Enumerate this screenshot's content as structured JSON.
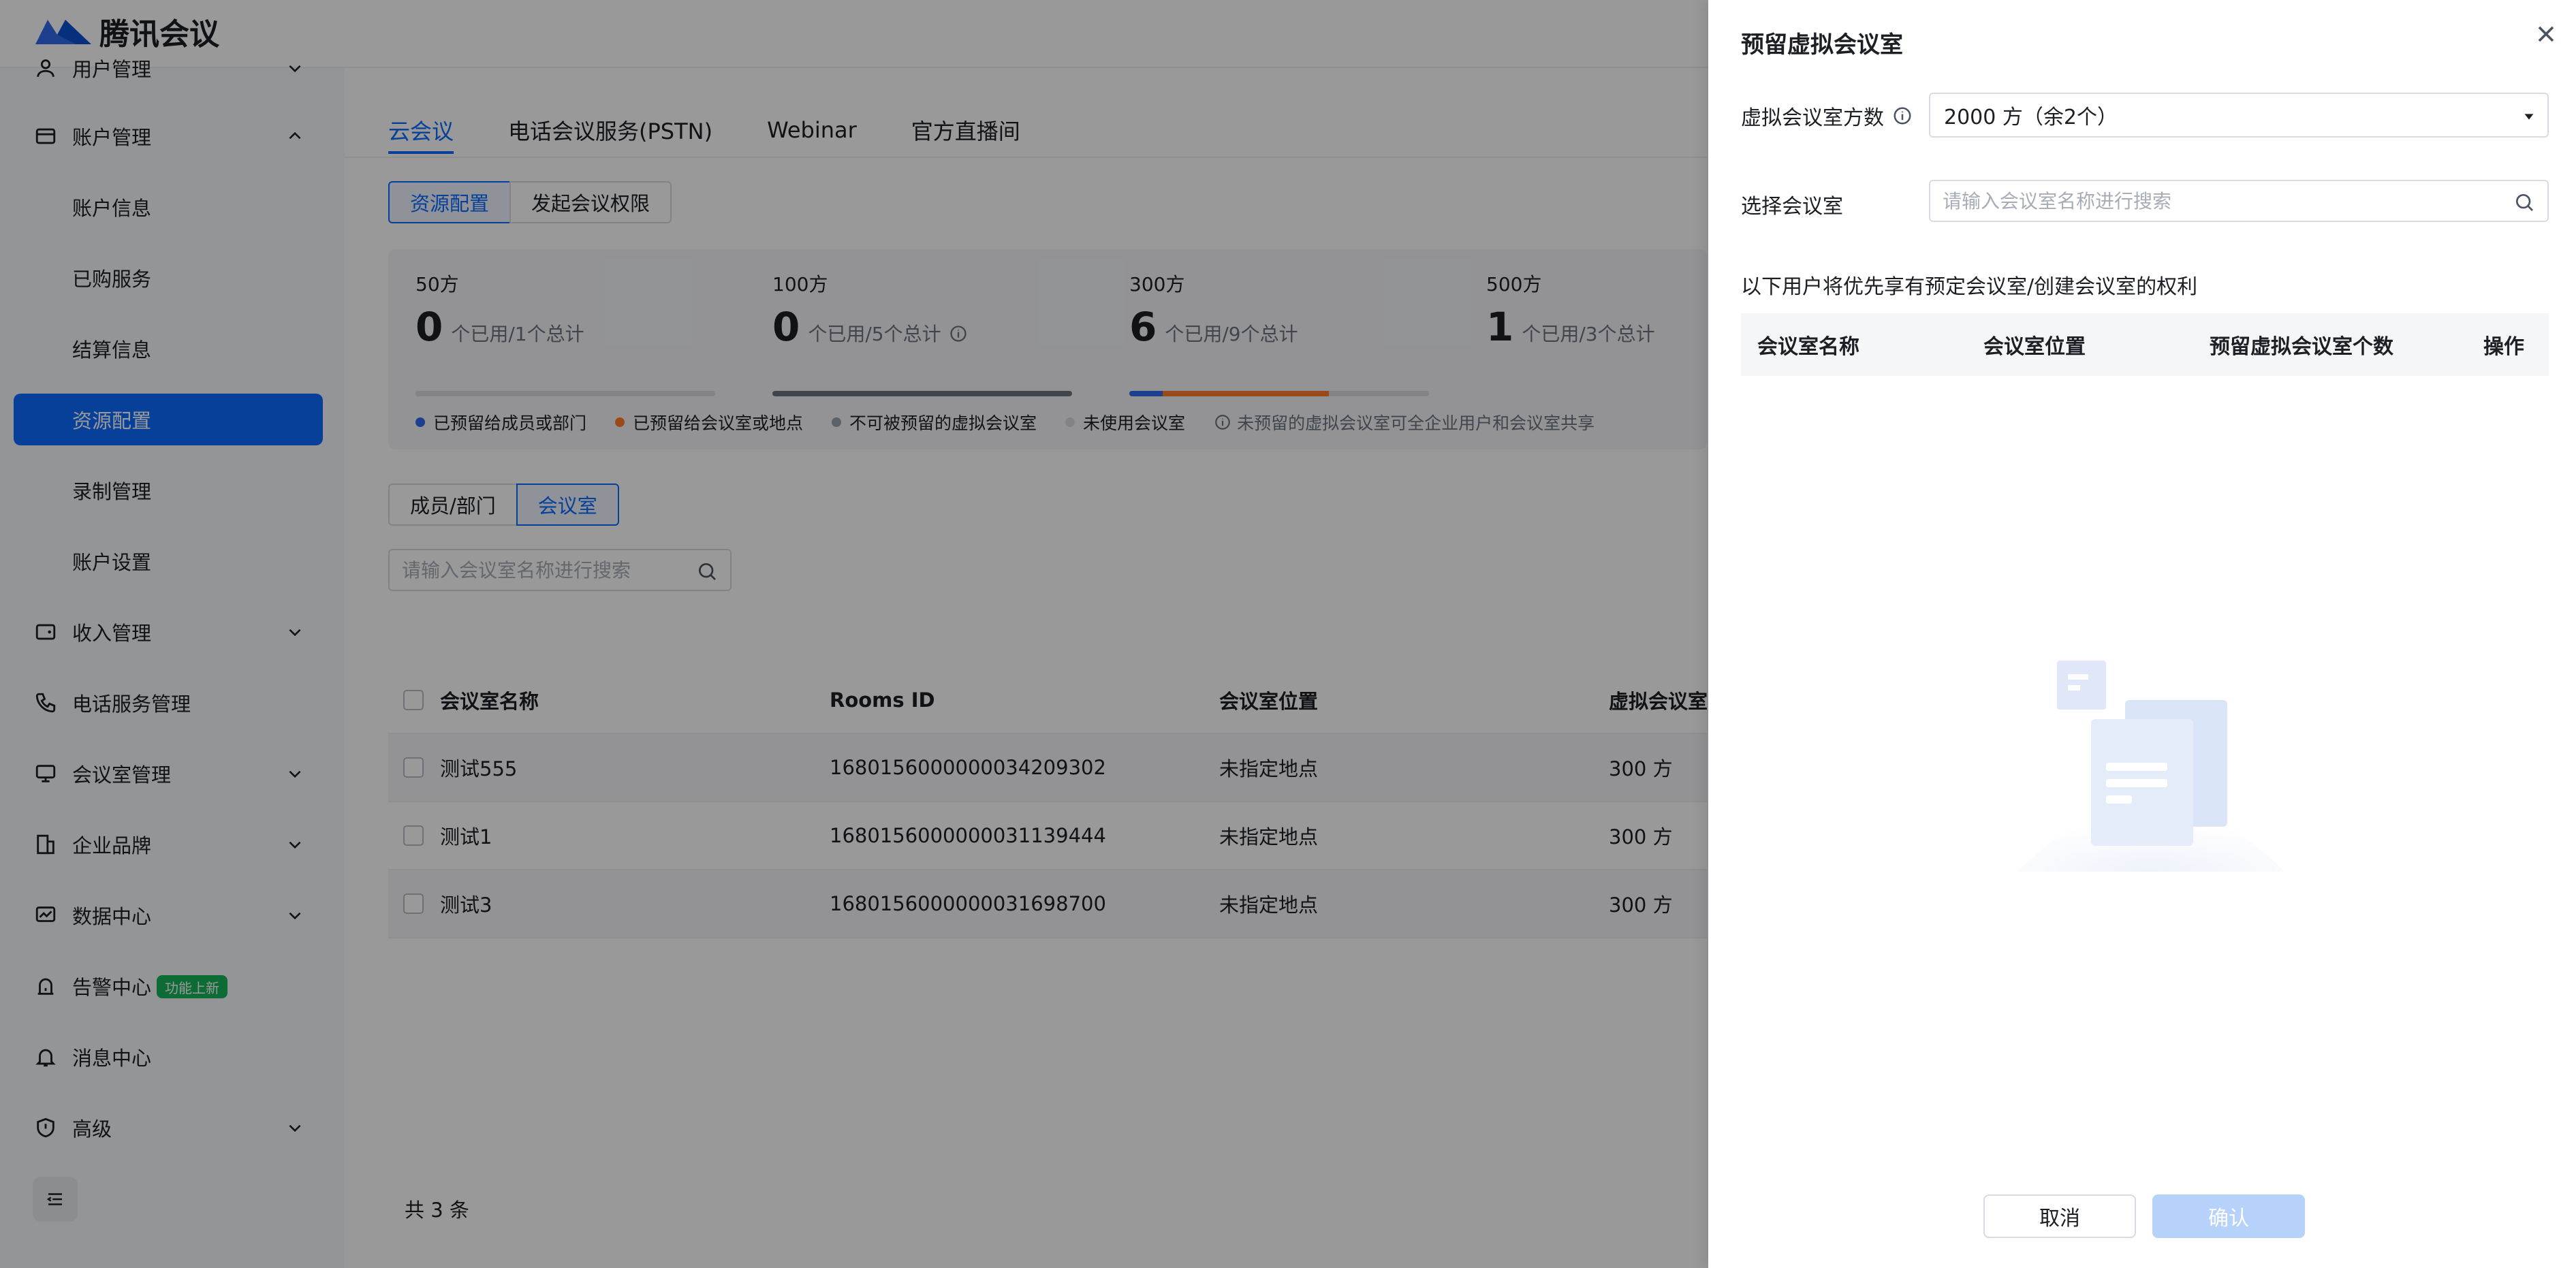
{
  "app": {
    "brand_name": "腾讯会议"
  },
  "sidebar": {
    "items": [
      {
        "label": "用户管理"
      },
      {
        "label": "账户管理"
      },
      {
        "label": "账户信息"
      },
      {
        "label": "已购服务"
      },
      {
        "label": "结算信息"
      },
      {
        "label": "资源配置"
      },
      {
        "label": "录制管理"
      },
      {
        "label": "账户设置"
      },
      {
        "label": "收入管理"
      },
      {
        "label": "电话服务管理"
      },
      {
        "label": "会议室管理"
      },
      {
        "label": "企业品牌"
      },
      {
        "label": "数据中心"
      },
      {
        "label": "告警中心",
        "badge": "功能上新"
      },
      {
        "label": "消息中心"
      },
      {
        "label": "高级"
      }
    ]
  },
  "main": {
    "tabs": [
      {
        "label": "云会议"
      },
      {
        "label": "电话会议服务(PSTN)"
      },
      {
        "label": "Webinar"
      },
      {
        "label": "官方直播间"
      }
    ],
    "segment_top": [
      "资源配置",
      "发起会议权限"
    ],
    "stats": [
      {
        "cap": "50方",
        "num": "0",
        "sub": "个已用/1个总计",
        "used": 0,
        "total": 1
      },
      {
        "cap": "100方",
        "num": "0",
        "sub": "个已用/5个总计",
        "used": 0,
        "total": 5
      },
      {
        "cap": "300方",
        "num": "6",
        "sub": "个已用/9个总计",
        "used": 6,
        "total": 9
      },
      {
        "cap": "500方",
        "num": "1",
        "sub": "个已用/3个总计",
        "used": 1,
        "total": 3
      }
    ],
    "legend": [
      {
        "label": "已预留给成员或部门",
        "color": "#2f6bec"
      },
      {
        "label": "已预留给会议室或地点",
        "color": "#ff7b2c"
      },
      {
        "label": "不可被预留的虚拟会议室",
        "color": "#9aa3af"
      },
      {
        "label": "未使用会议室",
        "color": "#d7dbe1"
      }
    ],
    "legend_note": "未预留的虚拟会议室可全企业用户和会议室共享",
    "segment_list": [
      "成员/部门",
      "会议室"
    ],
    "search_placeholder": "请输入会议室名称进行搜索",
    "table": {
      "headers": [
        "会议室名称",
        "Rooms ID",
        "会议室位置",
        "虚拟会议室"
      ],
      "rows": [
        {
          "name": "测试555",
          "id": "1680156000000034209302",
          "location": "未指定地点",
          "capacity": "300 方"
        },
        {
          "name": "测试1",
          "id": "1680156000000031139444",
          "location": "未指定地点",
          "capacity": "300 方"
        },
        {
          "name": "测试3",
          "id": "1680156000000031698700",
          "location": "未指定地点",
          "capacity": "300 方"
        }
      ]
    },
    "total": "共 3 条"
  },
  "drawer": {
    "title": "预留虚拟会议室",
    "count_label": "虚拟会议室方数",
    "count_value": "2000 方（余2个）",
    "room_label": "选择会议室",
    "room_placeholder": "请输入会议室名称进行搜索",
    "note": "以下用户将优先享有预定会议室/创建会议室的权利",
    "table_headers": [
      "会议室名称",
      "会议室位置",
      "预留虚拟会议室个数",
      "操作"
    ],
    "cancel_label": "取消",
    "confirm_label": "确认"
  },
  "colors": {
    "accent": "#0a6cff",
    "badge_green": "#16b35a"
  }
}
